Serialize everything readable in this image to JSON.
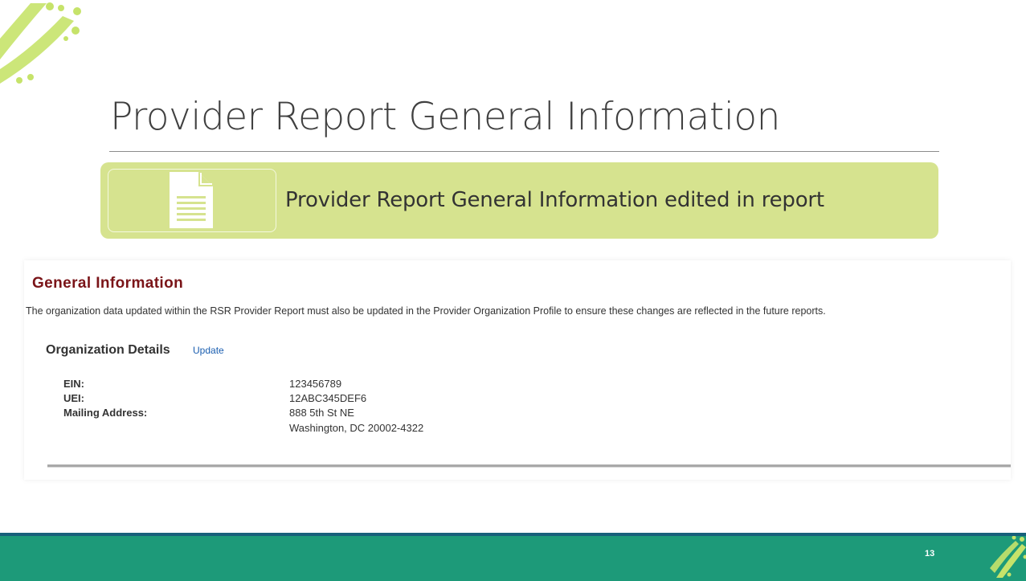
{
  "slide": {
    "title": "Provider Report General Information",
    "callout_text": "Provider Report General Information edited in report",
    "page_number": "13",
    "icons": {
      "logo": "dotted-swoosh-logo-icon",
      "callout": "document-icon"
    },
    "colors": {
      "callout_bg": "#d6e38f",
      "footer_bg": "#1d9a79",
      "footer_border": "#17607a",
      "logo_green": "#c6e36a"
    }
  },
  "screenshot": {
    "heading": "General Information",
    "description": "The organization data updated within the RSR Provider Report must also be updated in the Provider Organization Profile to ensure these changes are reflected in the future reports.",
    "org_details": {
      "title": "Organization Details",
      "update_link": "Update",
      "fields": [
        {
          "label": "EIN:",
          "value": "123456789"
        },
        {
          "label": "UEI:",
          "value": "12ABC345DEF6"
        },
        {
          "label": "Mailing Address:",
          "value": "888 5th St NE",
          "value2": "Washington, DC 20002-4322"
        }
      ]
    },
    "colors": {
      "heading": "#7a1418",
      "link": "#1a5eb0"
    }
  }
}
